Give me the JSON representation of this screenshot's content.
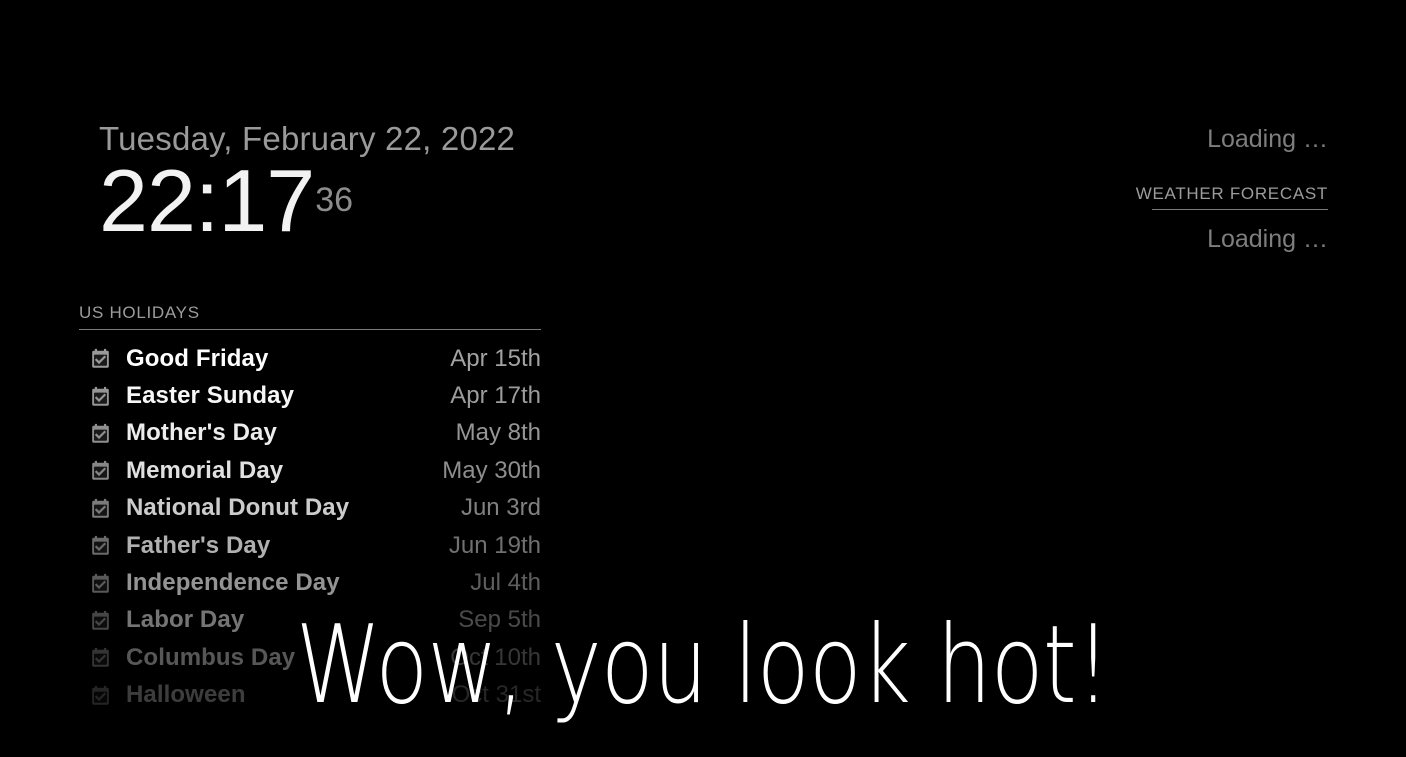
{
  "clock": {
    "date": "Tuesday, February 22, 2022",
    "time": "22:17",
    "seconds": "36"
  },
  "weather": {
    "current_status": "Loading …",
    "forecast_header": "WEATHER FORECAST",
    "forecast_status": "Loading …"
  },
  "holidays": {
    "header": "US HOLIDAYS",
    "icon": "calendar-check-icon",
    "items": [
      {
        "name": "Good Friday",
        "date": "Apr 15th",
        "opacity": 1.0
      },
      {
        "name": "Easter Sunday",
        "date": "Apr 17th",
        "opacity": 0.97
      },
      {
        "name": "Mother's Day",
        "date": "May 8th",
        "opacity": 0.93
      },
      {
        "name": "Memorial Day",
        "date": "May 30th",
        "opacity": 0.88
      },
      {
        "name": "National Donut Day",
        "date": "Jun 3rd",
        "opacity": 0.8
      },
      {
        "name": "Father's Day",
        "date": "Jun 19th",
        "opacity": 0.69
      },
      {
        "name": "Independence Day",
        "date": "Jul 4th",
        "opacity": 0.58
      },
      {
        "name": "Labor Day",
        "date": "Sep 5th",
        "opacity": 0.46
      },
      {
        "name": "Columbus Day",
        "date": "Oct 10th",
        "opacity": 0.34
      },
      {
        "name": "Halloween",
        "date": "Oct 31st",
        "opacity": 0.24
      }
    ]
  },
  "greeting": {
    "text": "Wow, you look hot!"
  },
  "colors": {
    "background": "#000000",
    "primary_text": "#ffffff",
    "secondary_text": "#a2a2a2",
    "muted_text": "#7e7e7e",
    "divider": "#7b7b7b",
    "icon": "#9a9a9a"
  }
}
